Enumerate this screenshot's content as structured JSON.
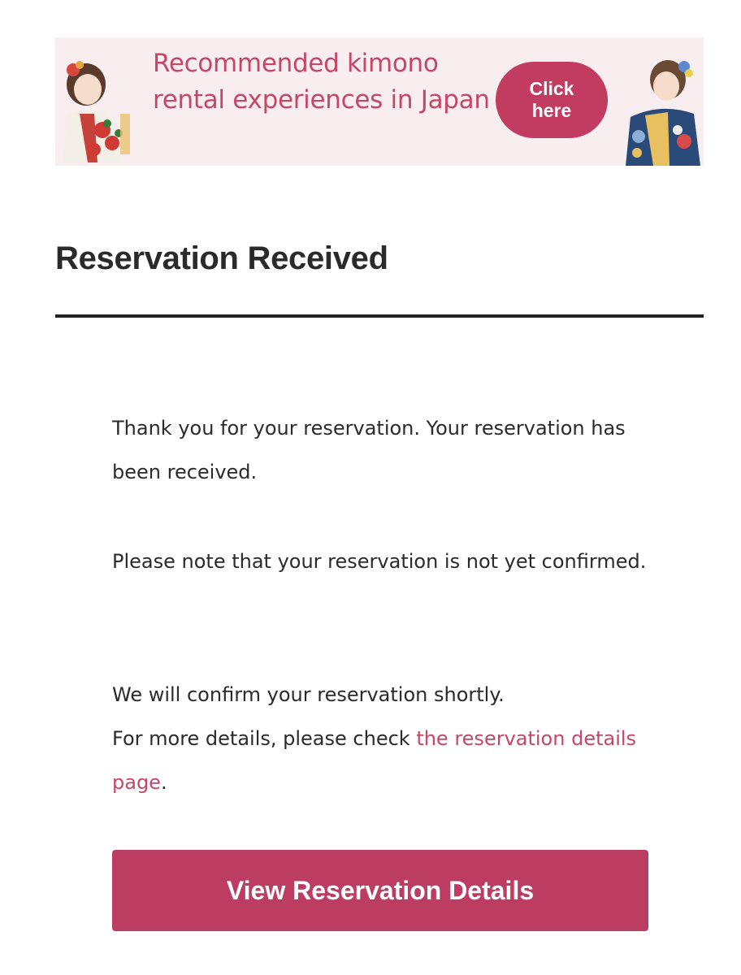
{
  "banner": {
    "text": "Recommended kimono rental experiences in Japan",
    "button_line1": "Click",
    "button_line2": "here"
  },
  "page": {
    "title": "Reservation Received"
  },
  "message": {
    "p1": "Thank you for your reservation. Your reservation has been received.",
    "p2": "Please note that your reservation is not yet confirmed.",
    "p3_line": "We will confirm your reservation shortly.",
    "p3_prefix": "For more details, please check ",
    "p3_link": "the reservation details page",
    "p3_suffix": "."
  },
  "actions": {
    "view_details": "View Reservation Details"
  },
  "colors": {
    "accent": "#c23c62",
    "banner_bg": "#f8eef0",
    "text": "#2a2a2a"
  }
}
